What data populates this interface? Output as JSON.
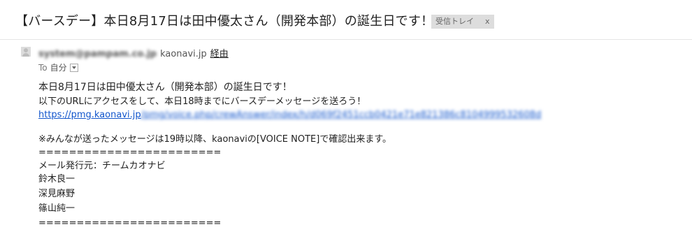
{
  "header": {
    "subject": "【バースデー】本日8月17日は田中優太さん（開発本部）の誕生日です！",
    "label": "受信トレイ",
    "label_close": "x"
  },
  "sender": {
    "email": "system@pampam.co.jp",
    "via_domain": "kaonavi.jp",
    "via_link": "経由",
    "to_label": "To",
    "to_value": "自分"
  },
  "body": {
    "line1": "本日8月17日は田中優太さん（開発本部）の誕生日です！",
    "line2": "以下のURLにアクセスをして、本日18時までにバースデーメッセージを送ろう！",
    "url_visible": "https://pmg.kaonavi.jp",
    "url_blurred": "/pmg/voice.php/crewAnswer/index/h/d069f2451ccb0421e71e821386c8104999532608d",
    "note": "※みんなが送ったメッセージは19時以降、kaonaviの[VOICE NOTE]で確認出来ます。",
    "separator": "========================",
    "from_line": "メール発行元：チームカオナビ",
    "names": [
      "鈴木良一",
      "深見麻野",
      "篠山純一"
    ],
    "separator_end": "========================"
  }
}
